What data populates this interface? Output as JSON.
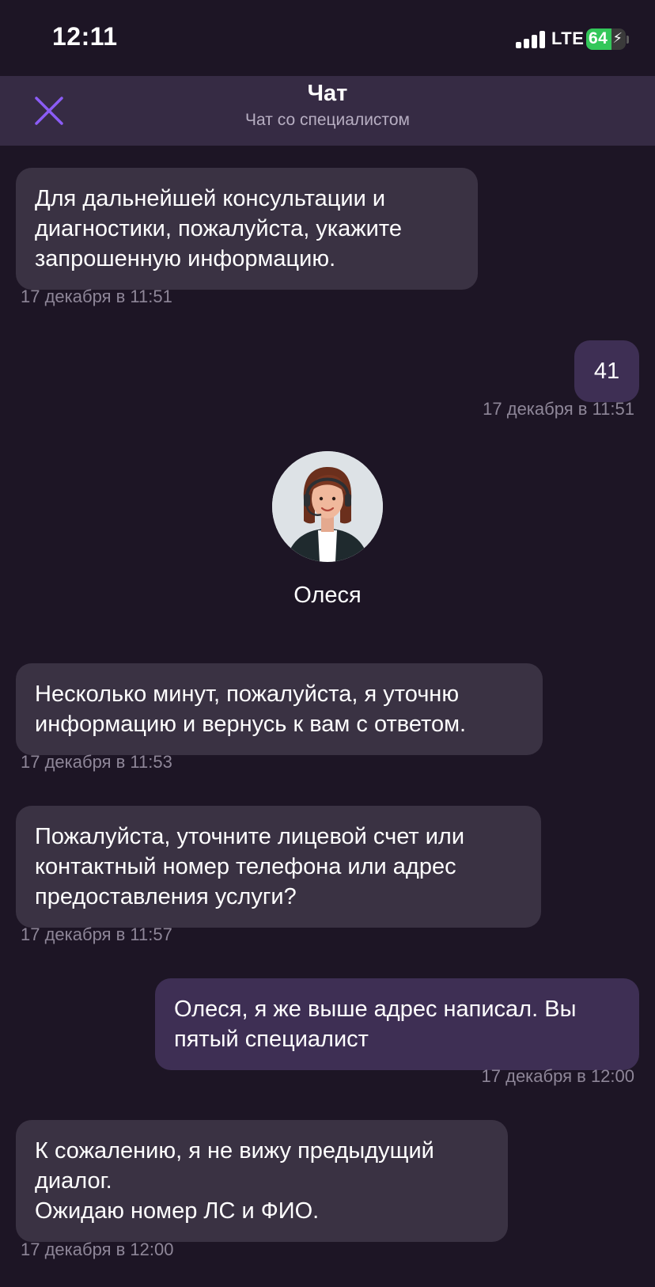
{
  "status_bar": {
    "time": "12:11",
    "network": "LTE",
    "battery_percent": "64",
    "battery_level": 0.64
  },
  "header": {
    "title": "Чат",
    "subtitle": "Чат со специалистом",
    "close_icon": "close-icon"
  },
  "messages": [
    {
      "direction": "incoming",
      "text": "Для дальнейшей консультации и\nдиагностики, пожалуйста, укажите\nзапрошенную информацию.",
      "time": "17 декабря в 11:51"
    },
    {
      "direction": "outgoing",
      "text": "41",
      "time": "17 декабря в 11:51"
    },
    {
      "direction": "incoming",
      "text": "Несколько минут, пожалуйста, я уточню\nинформацию и вернусь к вам с ответом.",
      "time": "17 декабря в 11:53"
    },
    {
      "direction": "incoming",
      "text": "Пожалуйста, уточните лицевой счет или\nконтактный номер телефона или адрес\nпредоставления услуги?",
      "time": "17 декабря в 11:57"
    },
    {
      "direction": "outgoing",
      "text": "Олеся, я же выше адрес написал. Вы\nпятый специалист",
      "time": "17 декабря в 12:00"
    },
    {
      "direction": "incoming",
      "text": "К сожалению, я не вижу предыдущий\nдиалог.\nОжидаю номер ЛС и ФИО.",
      "time": "17 декабря в 12:00"
    }
  ],
  "agent": {
    "name": "Олеся",
    "avatar_icon": "operator-avatar"
  },
  "colors": {
    "background": "#1d1525",
    "header": "#362b44",
    "incoming_bubble": "#3a3243",
    "outgoing_bubble": "#3e2f54",
    "accent": "#8b5cf6",
    "timestamp": "#8e8698"
  }
}
